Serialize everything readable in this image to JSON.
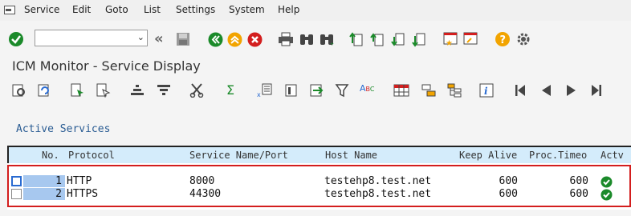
{
  "menu": {
    "items": [
      "Service",
      "Edit",
      "Goto",
      "List",
      "Settings",
      "System",
      "Help"
    ]
  },
  "command_field": {
    "value": ""
  },
  "screen_title": "ICM Monitor - Service Display",
  "section_title": "Active Services",
  "table": {
    "headers": [
      "No.",
      "Protocol",
      "Service Name/Port",
      "Host Name",
      "Keep Alive",
      "Proc.Timeo",
      "Actv"
    ],
    "rows": [
      {
        "no": "1",
        "protocol": "HTTP",
        "port": "8000",
        "host": "testehp8.test.net",
        "keep_alive": "600",
        "proc_timeout": "600",
        "active": true
      },
      {
        "no": "2",
        "protocol": "HTTPS",
        "port": "44300",
        "host": "testehp8.test.net",
        "keep_alive": "600",
        "proc_timeout": "600",
        "active": true
      }
    ]
  },
  "colors": {
    "header_bg": "#d4ecfb",
    "highlight_border": "#d31e1e",
    "section_title": "#2a5c93",
    "check_green": "#1b8a2a"
  }
}
